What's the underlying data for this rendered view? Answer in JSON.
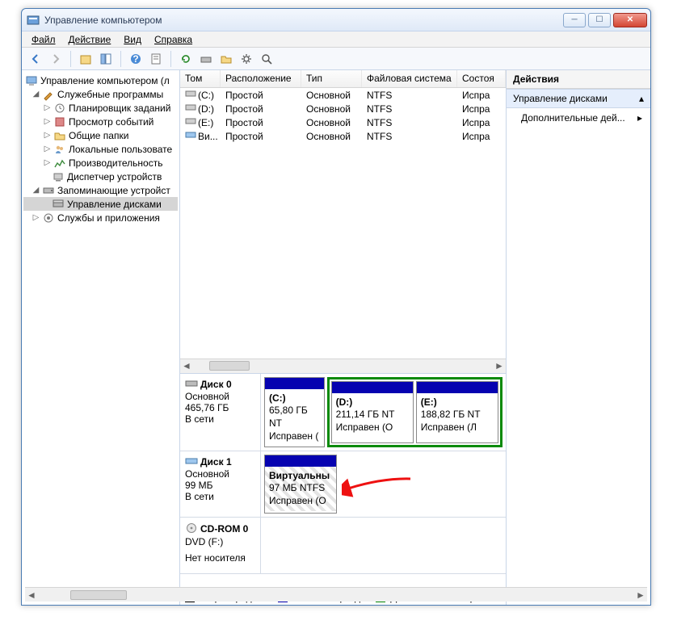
{
  "window": {
    "title": "Управление компьютером"
  },
  "menu": {
    "file": "Файл",
    "action": "Действие",
    "view": "Вид",
    "help": "Справка"
  },
  "tree": {
    "root": "Управление компьютером (л",
    "group1": "Служебные программы",
    "items1": [
      "Планировщик заданий",
      "Просмотр событий",
      "Общие папки",
      "Локальные пользовате",
      "Производительность",
      "Диспетчер устройств"
    ],
    "group2": "Запоминающие устройст",
    "disk_mgmt": "Управление дисками",
    "group3": "Службы и приложения"
  },
  "table": {
    "cols": {
      "vol": "Том",
      "layout": "Расположение",
      "type": "Тип",
      "fs": "Файловая система",
      "status": "Состоя"
    },
    "rows": [
      {
        "vol": "(C:)",
        "layout": "Простой",
        "type": "Основной",
        "fs": "NTFS",
        "status": "Испра"
      },
      {
        "vol": "(D:)",
        "layout": "Простой",
        "type": "Основной",
        "fs": "NTFS",
        "status": "Испра"
      },
      {
        "vol": "(E:)",
        "layout": "Простой",
        "type": "Основной",
        "fs": "NTFS",
        "status": "Испра"
      },
      {
        "vol": "Ви...",
        "layout": "Простой",
        "type": "Основной",
        "fs": "NTFS",
        "status": "Испра"
      }
    ]
  },
  "disks": {
    "d0": {
      "name": "Диск 0",
      "type": "Основной",
      "size": "465,76 ГБ",
      "state": "В сети"
    },
    "d0_parts": {
      "c": {
        "label": "(C:)",
        "size": "65,80 ГБ NT",
        "status": "Исправен ("
      },
      "d": {
        "label": "(D:)",
        "size": "211,14 ГБ NT",
        "status": "Исправен (О"
      },
      "e": {
        "label": "(E:)",
        "size": "188,82 ГБ NT",
        "status": "Исправен (Л"
      }
    },
    "d1": {
      "name": "Диск 1",
      "type": "Основной",
      "size": "99 МБ",
      "state": "В сети"
    },
    "d1_part": {
      "label": "Виртуальны",
      "size": "97 МБ NTFS",
      "status": "Исправен (О"
    },
    "cd": {
      "name": "CD-ROM 0",
      "type": "DVD (F:)",
      "state": "Нет носителя"
    }
  },
  "legend": {
    "unalloc": "Не распределен",
    "primary": "Основной раздел",
    "ext": "Дополнительный раз"
  },
  "actions": {
    "title": "Действия",
    "sub": "Управление дисками",
    "more": "Дополнительные дей..."
  }
}
